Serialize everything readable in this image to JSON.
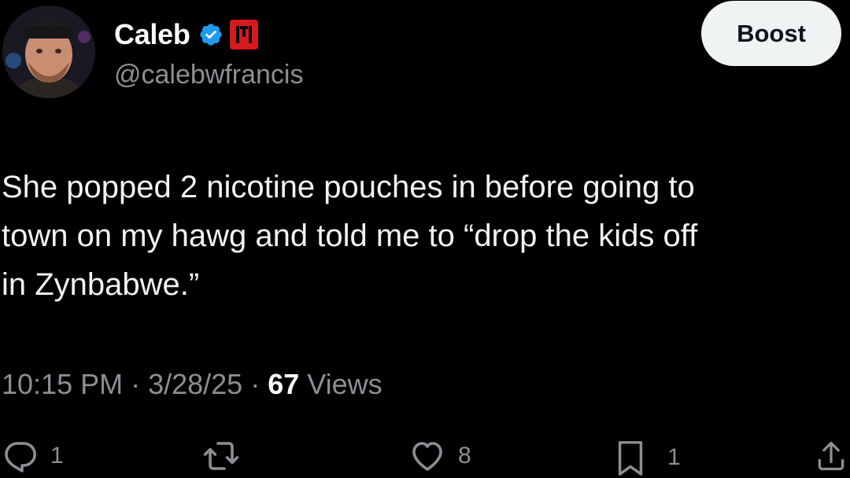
{
  "author": {
    "display_name": "Caleb",
    "handle": "@calebwfrancis",
    "verified": true,
    "verified_color": "#1d9bf0",
    "affiliate_badge_color": "#d71920"
  },
  "boost_button": {
    "label": "Boost"
  },
  "tweet": {
    "text": "She popped 2 nicotine pouches in before going to\ntown on my hawg and told me to “drop the kids off\nin Zynbabwe.”"
  },
  "meta": {
    "time": "10:15 PM",
    "separator": "·",
    "date": "3/28/25",
    "views_count": "67",
    "views_label": "Views"
  },
  "actions": {
    "reply": {
      "icon": "reply-icon",
      "count": "1"
    },
    "repost": {
      "icon": "repost-icon",
      "count": ""
    },
    "like": {
      "icon": "like-icon",
      "count": "8"
    },
    "bookmark": {
      "icon": "bookmark-icon",
      "count": "1"
    },
    "share": {
      "icon": "share-icon"
    }
  }
}
